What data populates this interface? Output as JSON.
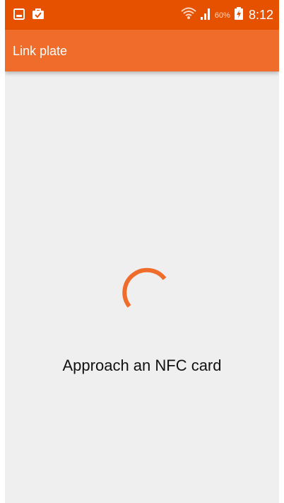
{
  "status_bar": {
    "left_icons": [
      "image-icon",
      "briefcase-check-icon"
    ],
    "right_icons": [
      "wifi-icon",
      "signal-icon",
      "battery-charging-icon"
    ],
    "battery_percent": "60%",
    "time": "8:12",
    "colors": {
      "background": "#e65100"
    }
  },
  "app_bar": {
    "title": "Link plate",
    "colors": {
      "background": "#ef6c2a",
      "text": "#ffffff"
    }
  },
  "main": {
    "spinner_icon": "progress-spinner-icon",
    "prompt": "Approach an NFC card",
    "colors": {
      "background": "#efefef",
      "accent": "#ef6c2a",
      "text": "#111111"
    }
  }
}
